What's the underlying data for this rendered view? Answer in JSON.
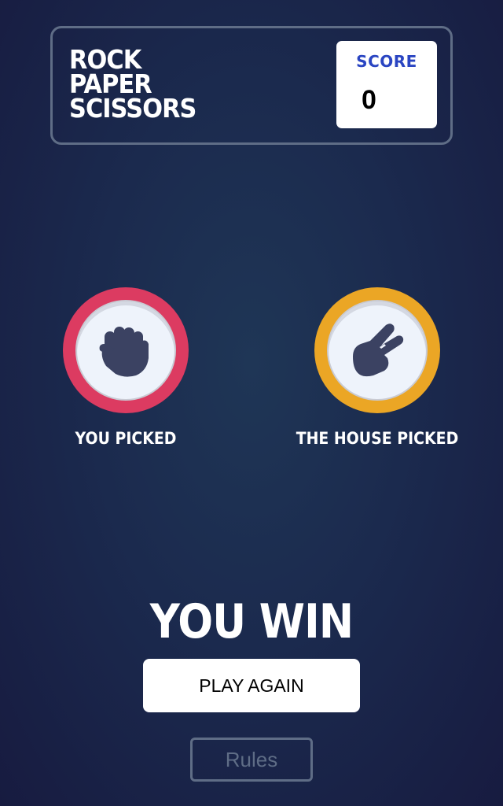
{
  "header": {
    "title_lines": [
      "ROCK",
      "PAPER",
      "SCISSORS"
    ],
    "score_label": "SCORE",
    "score_value": "0"
  },
  "game": {
    "player_pick": {
      "choice": "rock",
      "icon": "rock-hand-icon",
      "ring_color": "#dc3b61",
      "label": "YOU PICKED"
    },
    "house_pick": {
      "choice": "scissors",
      "icon": "scissors-hand-icon",
      "ring_color": "#eba625",
      "label": "THE HOUSE PICKED"
    },
    "result_text": "YOU WIN",
    "play_again_label": "PLAY AGAIN"
  },
  "footer": {
    "rules_label": "Rules"
  },
  "colors": {
    "score_label": "#2a45c2",
    "header_outline": "#5f6d86",
    "icon_fill": "#3b4262"
  }
}
